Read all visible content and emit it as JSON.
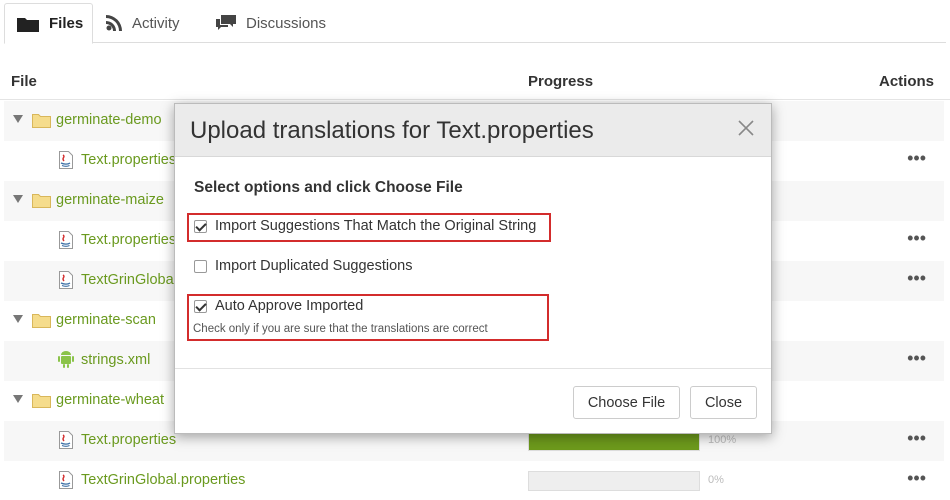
{
  "tabs": [
    {
      "label": "Files",
      "icon": "folder-icon",
      "active": true
    },
    {
      "label": "Activity",
      "icon": "rss-icon"
    },
    {
      "label": "Discussions",
      "icon": "comments-icon"
    }
  ],
  "table": {
    "headers": {
      "file": "File",
      "progress": "Progress",
      "actions": "Actions"
    },
    "rows": [
      {
        "type": "folder",
        "name": "germinate-demo"
      },
      {
        "type": "file",
        "name": "Text.properties",
        "icon": "java-file-icon",
        "actions": "•••"
      },
      {
        "type": "folder",
        "name": "germinate-maize"
      },
      {
        "type": "file",
        "name": "Text.properties",
        "icon": "java-file-icon",
        "actions": "•••"
      },
      {
        "type": "file",
        "name": "TextGrinGlobal.properties",
        "icon": "java-file-icon",
        "actions": "•••"
      },
      {
        "type": "folder",
        "name": "germinate-scan"
      },
      {
        "type": "file",
        "name": "strings.xml",
        "icon": "android-file-icon",
        "actions": "•••"
      },
      {
        "type": "folder",
        "name": "germinate-wheat"
      },
      {
        "type": "file",
        "name": "Text.properties",
        "icon": "java-file-icon",
        "actions": "•••",
        "progress": 1.0,
        "progress_label": "100%"
      },
      {
        "type": "file",
        "name": "TextGrinGlobal.properties",
        "icon": "java-file-icon",
        "actions": "•••",
        "progress": 0.0,
        "progress_label": "0%"
      }
    ]
  },
  "modal": {
    "title": "Upload translations for Text.properties",
    "subtitle": "Select options and click Choose File",
    "options": [
      {
        "label": "Import Suggestions That Match the Original String",
        "checked": true
      },
      {
        "label": "Import Duplicated Suggestions",
        "checked": false
      },
      {
        "label": "Auto Approve Imported",
        "checked": true
      }
    ],
    "hint": "Check only if you are sure that the translations are correct",
    "buttons": {
      "choose": "Choose File",
      "close": "Close"
    }
  },
  "colors": {
    "link_green": "#6a9a1f",
    "progress_green": "#6d9a1c",
    "highlight_red": "#d32c2c"
  }
}
